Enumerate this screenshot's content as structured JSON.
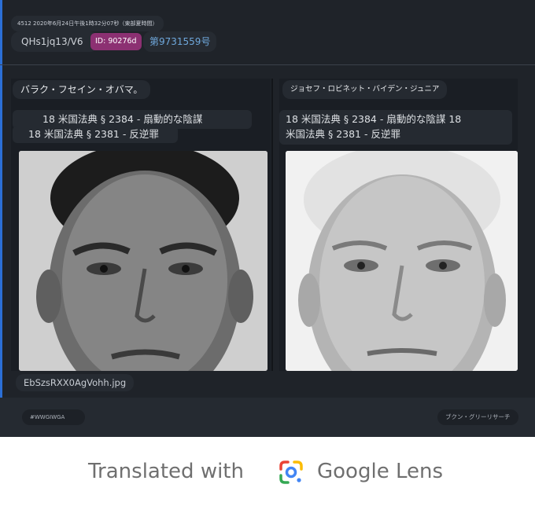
{
  "post": {
    "meta": "4512 2020年6月24日午後1時32分07秒（東部夏時間）",
    "username": "QHs1jq13/V6",
    "id_badge": "ID: 90276d",
    "post_number": "第9731559号",
    "filename": "EbSzsRXX0AgVohh.jpg",
    "tag": "#WWGIWGA",
    "research_label": "ブクン・グリーリサーチ"
  },
  "left_panel": {
    "name": "バラク・フセイン・オバマ。",
    "caption_line1": "18 米国法典 § 2384 - 扇動的な陰謀",
    "caption_line2": "18 米国法典 § 2381 - 反逆罪"
  },
  "right_panel": {
    "name": "ジョセフ・ロビネット・バイデン・ジュニア",
    "caption_line1": "18 米国法典 § 2384 - 扇動的な陰謀 18",
    "caption_line2": "米国法典 § 2381 - 反逆罪"
  },
  "watermark": {
    "prefix": "Translated with",
    "brand": "Google Lens",
    "icon": "google-lens-icon"
  },
  "colors": {
    "background": "#1f2329",
    "id_badge": "#8c3072",
    "post_number": "#6fa8dc",
    "watermark_text": "#6f6f6f"
  }
}
